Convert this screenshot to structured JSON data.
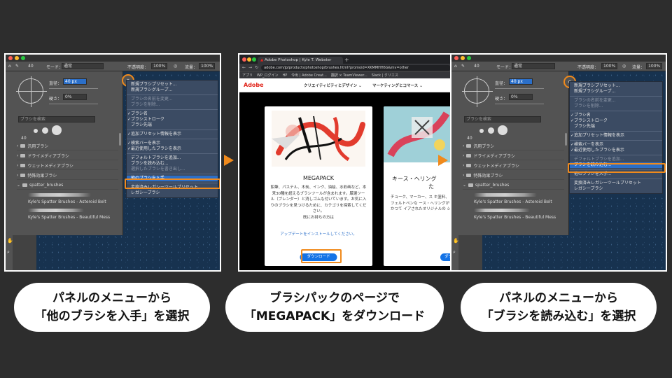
{
  "steps": [
    {
      "caption_line1": "パネルのメニューから",
      "caption_line2": "「他のブラシを入手」を選択"
    },
    {
      "caption_line1": "ブラシパックのページで",
      "caption_line2": "「MEGAPACK」をダウンロード"
    },
    {
      "caption_line1": "パネルのメニューから",
      "caption_line2": "「ブラシを読み込む」を選択"
    }
  ],
  "photoshop": {
    "options": {
      "mode_label": "モード：",
      "mode_value": "通常",
      "opacity_label": "不透明度：",
      "opacity_value": "100%",
      "flow_label": "流量：",
      "flow_value": "100%",
      "brush_size_small": "40"
    },
    "brush_panel": {
      "size_label": "直径：",
      "size_value": "40 px",
      "hardness_label": "硬さ：",
      "hardness_value": "0%",
      "search_placeholder": "ブラシを検索",
      "swatch_label": "40",
      "folders": [
        "汎用ブラシ",
        "ドライメディアブラシ",
        "ウェットメディアブラシ",
        "特殊効果ブラシ",
        "spatter_brushes"
      ],
      "brushes": [
        "Kyle's Spatter Brushes - Asteroid Belt",
        "Kyle's Spatter Brushes - Beautiful Mess"
      ]
    },
    "settings_icon_label": "⚙",
    "menu1": [
      {
        "label": "新規ブラシプリセット...",
        "state": "normal"
      },
      {
        "label": "新規ブラシグループ...",
        "state": "normal"
      },
      {
        "label": "",
        "state": "sep"
      },
      {
        "label": "ブラシの名前を変更...",
        "state": "disabled"
      },
      {
        "label": "ブラシを削除...",
        "state": "disabled"
      },
      {
        "label": "",
        "state": "sep"
      },
      {
        "label": "ブラシ名",
        "state": "check"
      },
      {
        "label": "ブラシストローク",
        "state": "check"
      },
      {
        "label": "ブラシ先端",
        "state": "normal"
      },
      {
        "label": "",
        "state": "sep"
      },
      {
        "label": "追加プリセット情報を表示",
        "state": "check"
      },
      {
        "label": "",
        "state": "sep"
      },
      {
        "label": "検索バーを表示",
        "state": "check"
      },
      {
        "label": "最近使用したブラシを表示",
        "state": "check"
      },
      {
        "label": "",
        "state": "sep"
      },
      {
        "label": "デフォルトブラシを追加...",
        "state": "normal"
      },
      {
        "label": "ブラシを読み込む...",
        "state": "normal"
      },
      {
        "label": "選択したブラシを書き出し...",
        "state": "disabled"
      },
      {
        "label": "",
        "state": "sep"
      },
      {
        "label": "他のブラシを入手...",
        "state": "highlight"
      },
      {
        "label": "",
        "state": "sep"
      },
      {
        "label": "変換済みレガシーツールプリセット",
        "state": "normal"
      },
      {
        "label": "レガシーブラシ",
        "state": "normal"
      }
    ],
    "menu2": [
      {
        "label": "新規ブラシプリセット...",
        "state": "normal"
      },
      {
        "label": "新規ブラシグループ...",
        "state": "normal"
      },
      {
        "label": "",
        "state": "sep"
      },
      {
        "label": "ブラシの名前を変更...",
        "state": "disabled"
      },
      {
        "label": "ブラシを削除...",
        "state": "disabled"
      },
      {
        "label": "",
        "state": "sep"
      },
      {
        "label": "ブラシ名",
        "state": "check"
      },
      {
        "label": "ブラシストローク",
        "state": "check"
      },
      {
        "label": "ブラシ先端",
        "state": "normal"
      },
      {
        "label": "",
        "state": "sep"
      },
      {
        "label": "追加プリセット情報を表示",
        "state": "check"
      },
      {
        "label": "",
        "state": "sep"
      },
      {
        "label": "検索バーを表示",
        "state": "check"
      },
      {
        "label": "最近使用したブラシを表示",
        "state": "check"
      },
      {
        "label": "",
        "state": "sep"
      },
      {
        "label": "デフォルトブラシを追加...",
        "state": "disabled"
      },
      {
        "label": "ブラシを読み込む...",
        "state": "highlight"
      },
      {
        "label": "",
        "state": "sep"
      },
      {
        "label": "他のブラシを入手...",
        "state": "normal"
      },
      {
        "label": "",
        "state": "sep"
      },
      {
        "label": "変換済みレガシーツールプリセット",
        "state": "normal"
      },
      {
        "label": "レガシーブラシ",
        "state": "normal"
      }
    ]
  },
  "browser": {
    "tab_title": "Adobe Photoshop | Kyle T. Webster",
    "new_tab": "+",
    "url": "adobe.com/jp/products/photoshop/brushes.html?promoid=XKMMHH6G&mv=other",
    "bookmarks": [
      "アプリ",
      "WP_ログイン",
      "HP",
      "今出 | Adobe Creat...",
      "翻訳 × TeamViewer...",
      "Slack | クリエス"
    ],
    "nav": {
      "logo": "Adobe",
      "item1": "クリエイティビティとデザイン ⌄",
      "item2": "マーケティングとコマース ⌄"
    },
    "card1": {
      "title": "MEGAPACK",
      "desc": "鉛筆、パステル、木炭、インク、油絵、水彩画など、本来30種を超えるブラシツールが含まれます。厳選ツール（ブレンダー）と消しゴムも付いています。お気に入りのブラシを見つけるために、カテゴリを探索してください。",
      "note": "既にお持ちの方は",
      "link": "アップデートをインストールしてください。",
      "cta": "ダウンロード"
    },
    "card2": {
      "title": "キース・ヘリング",
      "title2": "た",
      "desc": "チョーク、マーカー、ス キ塗料、フェルトペンな ース・ヘリングがかつて イアされたオリジナルの シ",
      "cta": "ダウ"
    }
  },
  "colors": {
    "background": "#2d2d2d",
    "accent": "#f08a1c",
    "highlight": "#2b6fc9"
  }
}
